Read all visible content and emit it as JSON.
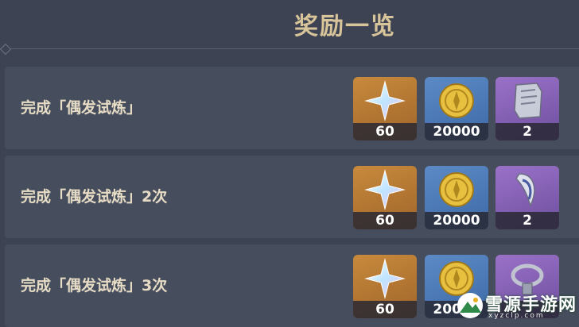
{
  "header": {
    "title": "奖励一览"
  },
  "rows": [
    {
      "label": "完成「偶发试炼」",
      "rewards": [
        {
          "icon": "primogem-icon",
          "qty": "60"
        },
        {
          "icon": "mora-coin-icon",
          "qty": "20000"
        },
        {
          "icon": "scroll-material-icon",
          "qty": "2"
        }
      ]
    },
    {
      "label": "完成「偶发试炼」2次",
      "rewards": [
        {
          "icon": "primogem-icon",
          "qty": "60"
        },
        {
          "icon": "mora-coin-icon",
          "qty": "20000"
        },
        {
          "icon": "horn-material-icon",
          "qty": "2"
        }
      ]
    },
    {
      "label": "完成「偶发试炼」3次",
      "rewards": [
        {
          "icon": "primogem-icon",
          "qty": "60"
        },
        {
          "icon": "mora-coin-icon",
          "qty": "20000"
        },
        {
          "icon": "chain-material-icon",
          "qty": ""
        }
      ]
    }
  ],
  "watermark": {
    "name": "雪源手游网",
    "url": "xyzclp.com"
  },
  "colors": {
    "background": "#3d4352",
    "row": "#464d5d",
    "title": "#d8c49a",
    "label": "#e6dbc4",
    "rarity_gold": "#c88a3c",
    "rarity_blue": "#5c8ac6",
    "rarity_purple": "#9a72c8"
  }
}
